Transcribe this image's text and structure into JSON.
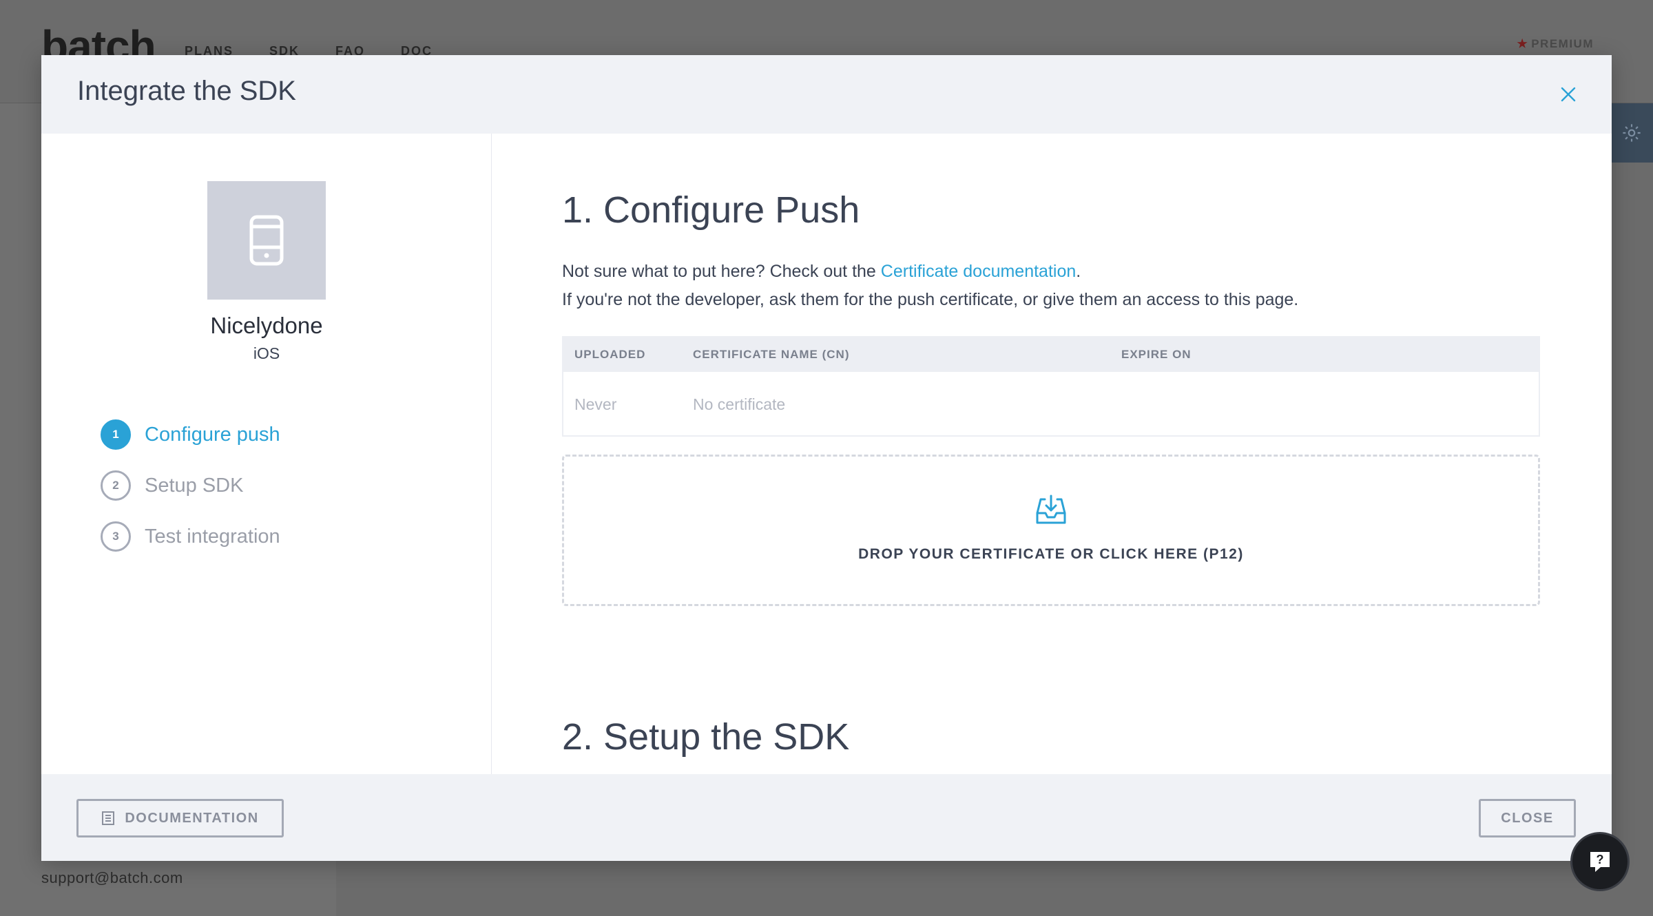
{
  "background": {
    "logo": "batch",
    "nav": [
      "PLANS",
      "SDK",
      "FAQ",
      "DOC"
    ],
    "premium_label": "PREMIUM",
    "support_email": "support@batch.com"
  },
  "modal": {
    "title": "Integrate the SDK",
    "app": {
      "name": "Nicelydone",
      "platform": "iOS",
      "icon": "phone-icon"
    },
    "steps": [
      {
        "number": "1",
        "label": "Configure push",
        "active": true
      },
      {
        "number": "2",
        "label": "Setup SDK",
        "active": false
      },
      {
        "number": "3",
        "label": "Test integration",
        "active": false
      }
    ],
    "section1": {
      "title": "1. Configure Push",
      "desc_prefix": "Not sure what to put here? Check out the ",
      "desc_link": "Certificate documentation",
      "desc_suffix": ".",
      "desc_line2": "If you're not the developer, ask them for the push certificate, or give them an access to this page."
    },
    "cert_table": {
      "columns": [
        "UPLOADED",
        "CERTIFICATE NAME (CN)",
        "EXPIRE ON"
      ],
      "rows": [
        [
          "Never",
          "No certificate",
          ""
        ]
      ]
    },
    "dropzone": {
      "icon": "inbox-download-icon",
      "label": "DROP YOUR CERTIFICATE OR CLICK HERE (P12)"
    },
    "section2": {
      "title": "2. Setup the SDK"
    },
    "footer": {
      "documentation_label": "DOCUMENTATION",
      "close_label": "CLOSE"
    }
  },
  "colors": {
    "accent": "#2aa2d6",
    "overlay": "#6b6b6b",
    "modal_header": "#f0f2f6"
  }
}
